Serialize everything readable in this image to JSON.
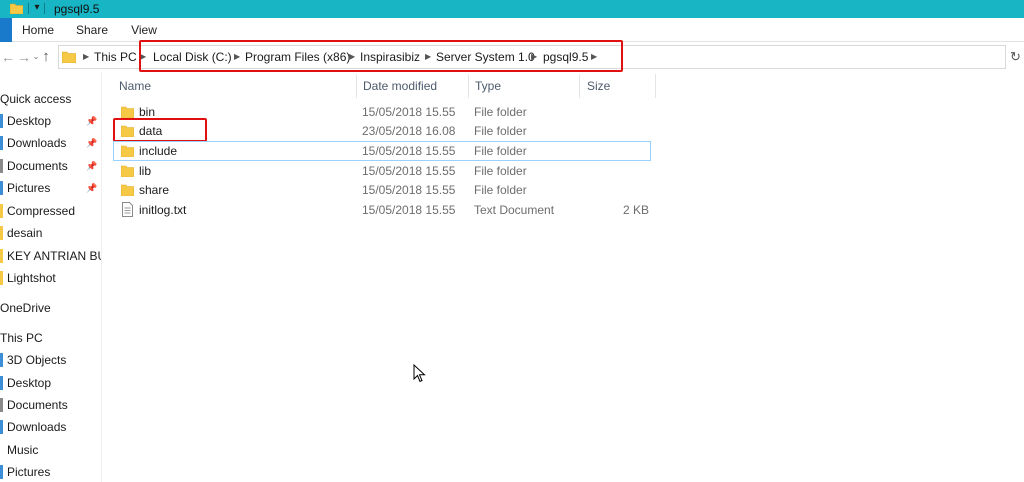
{
  "window": {
    "title": "pgsql9.5"
  },
  "ribbon": {
    "tabs": [
      "Home",
      "Share",
      "View"
    ]
  },
  "breadcrumb": {
    "root": "This PC",
    "segments": [
      "Local Disk (C:)",
      "Program Files (x86)",
      "Inspirasibiz",
      "Server System 1.0",
      "pgsql9.5"
    ]
  },
  "columns": {
    "name": "Name",
    "date": "Date modified",
    "type": "Type",
    "size": "Size"
  },
  "files": [
    {
      "name": "bin",
      "date": "15/05/2018 15.55",
      "type": "File folder",
      "size": "",
      "icon": "folder-icon"
    },
    {
      "name": "data",
      "date": "23/05/2018 16.08",
      "type": "File folder",
      "size": "",
      "icon": "folder-icon"
    },
    {
      "name": "include",
      "date": "15/05/2018 15.55",
      "type": "File folder",
      "size": "",
      "icon": "folder-icon"
    },
    {
      "name": "lib",
      "date": "15/05/2018 15.55",
      "type": "File folder",
      "size": "",
      "icon": "folder-icon"
    },
    {
      "name": "share",
      "date": "15/05/2018 15.55",
      "type": "File folder",
      "size": "",
      "icon": "folder-icon"
    },
    {
      "name": "initlog.txt",
      "date": "15/05/2018 15.55",
      "type": "Text Document",
      "size": "2 KB",
      "icon": "text-file-icon"
    }
  ],
  "navpane": {
    "quick_access": "Quick access",
    "quick_items": [
      "Desktop",
      "Downloads",
      "Documents",
      "Pictures",
      "Compressed",
      "desain",
      "KEY ANTRIAN BUA",
      "Lightshot"
    ],
    "onedrive": "OneDrive",
    "this_pc": "This PC",
    "pc_items": [
      "3D Objects",
      "Desktop",
      "Documents",
      "Downloads",
      "Music",
      "Pictures"
    ]
  },
  "colors": {
    "titlebar": "#18b5c4",
    "file_tab": "#1979ca",
    "folder_yellow": "#f5c846",
    "annotation_red": "#e01010",
    "selection_border": "#99d1ff"
  }
}
